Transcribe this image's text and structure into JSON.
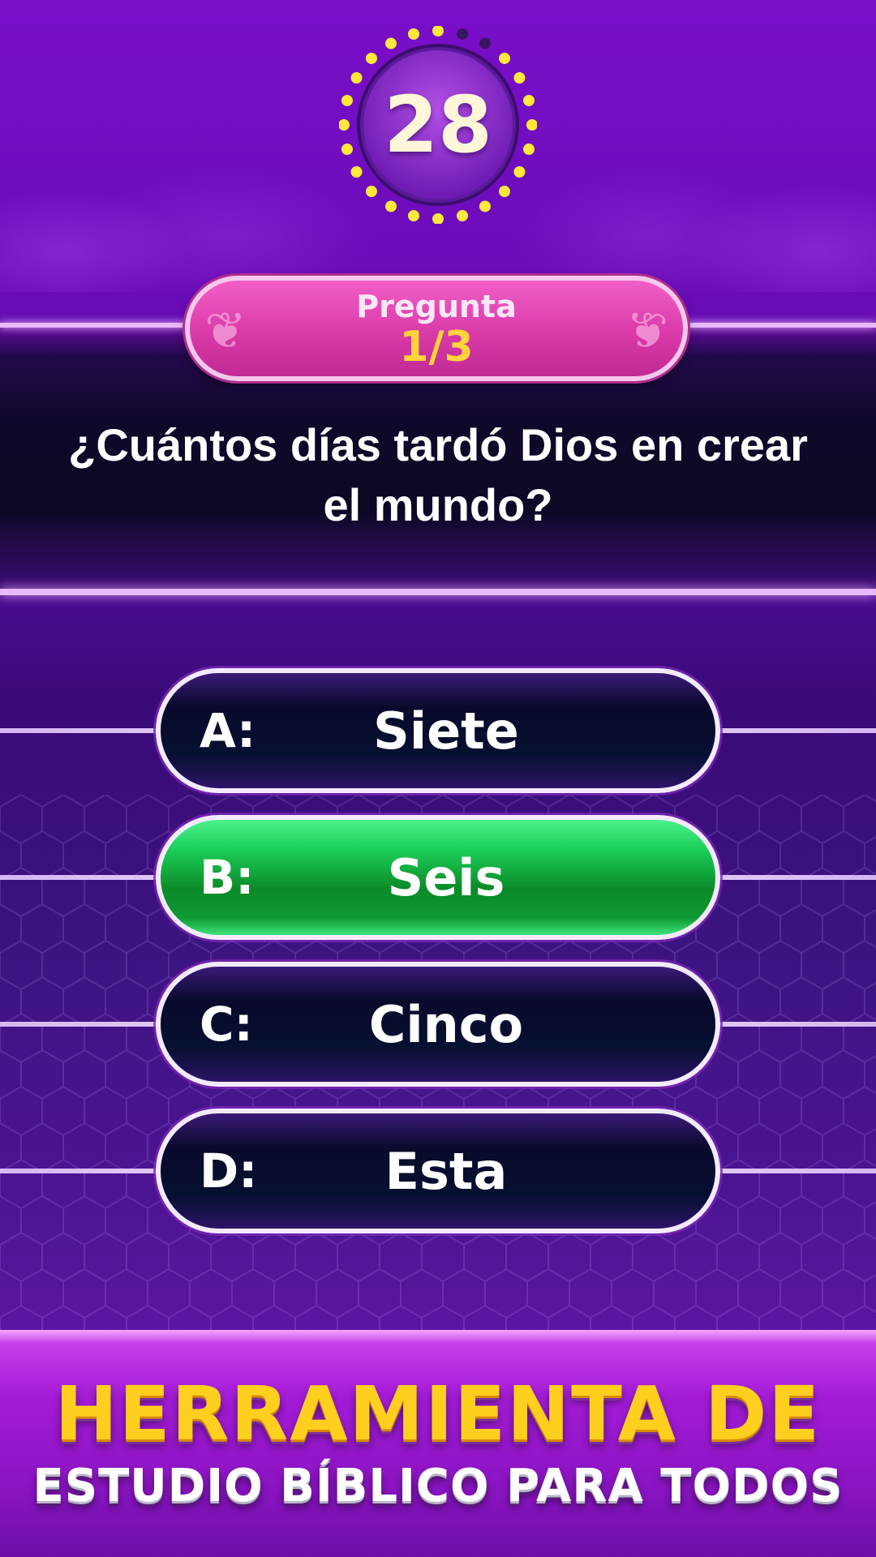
{
  "timer": {
    "value": "28"
  },
  "question_header": {
    "label": "Pregunta",
    "counter": "1/3"
  },
  "question": {
    "text": "¿Cuántos días tardó Dios en crear el mundo?"
  },
  "answers": [
    {
      "letter": "A:",
      "text": "Siete",
      "state": "default"
    },
    {
      "letter": "B:",
      "text": "Seis",
      "state": "correct"
    },
    {
      "letter": "C:",
      "text": "Cinco",
      "state": "default"
    },
    {
      "letter": "D:",
      "text": "Esta",
      "state": "default"
    }
  ],
  "banner": {
    "line1": "HERRAMIENTA DE",
    "line2": "ESTUDIO BÍBLICO PARA TODOS"
  },
  "colors": {
    "timer_dot_active": "#ffe83a",
    "timer_dot_spent": "#3a1560",
    "correct_answer": "#1cd05a",
    "pregunta_badge": "#e04cb4",
    "counter_text": "#ffd43a",
    "banner_line1": "#ffcf1f"
  }
}
